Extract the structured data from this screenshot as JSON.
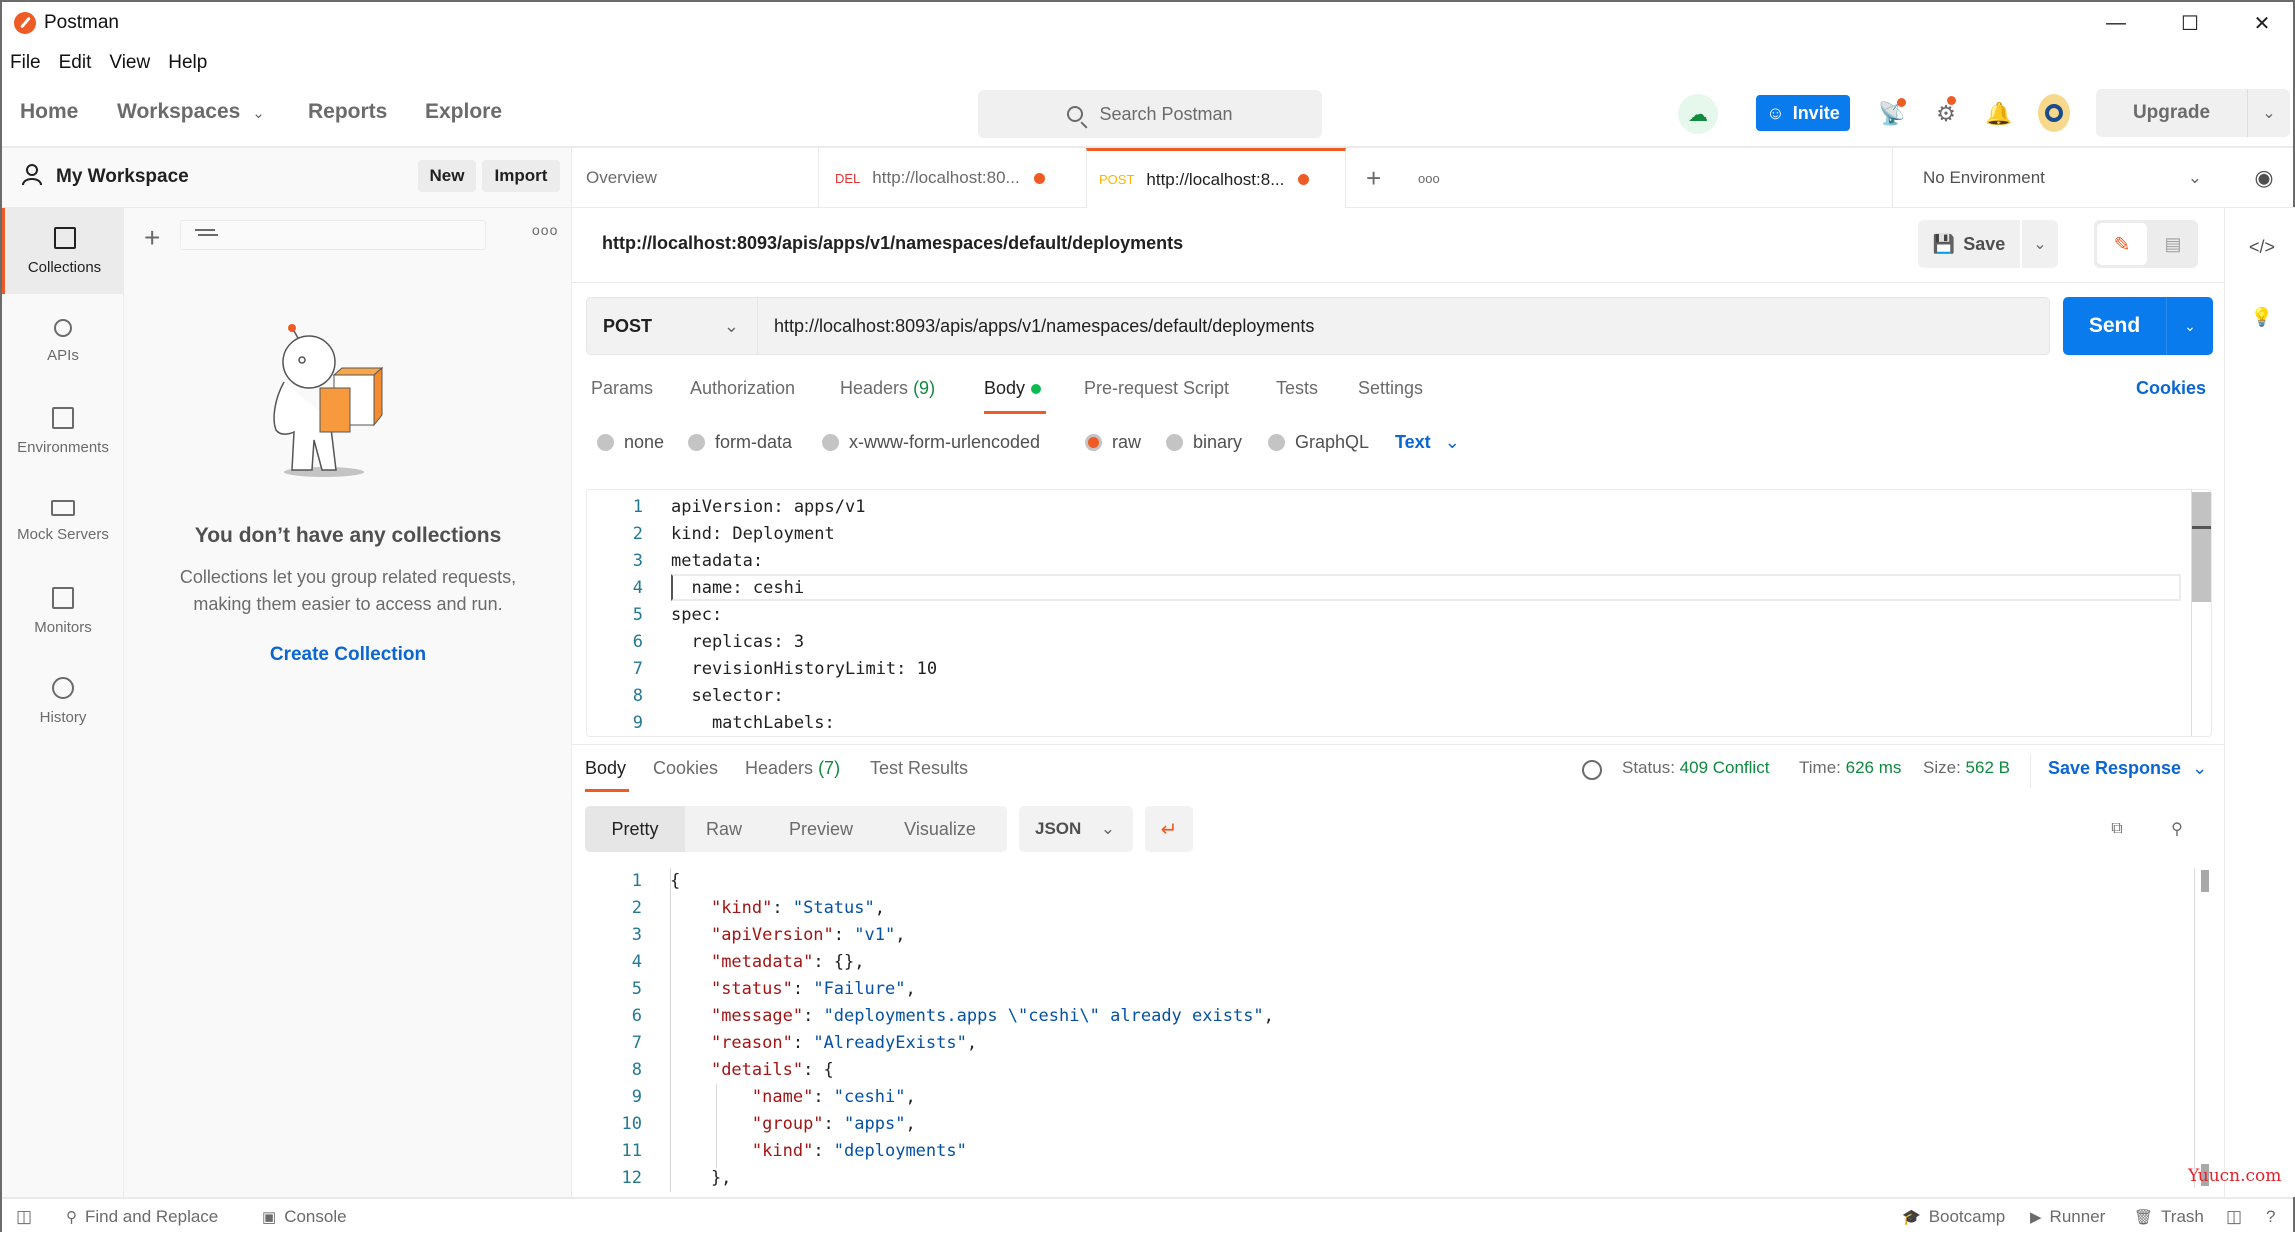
{
  "window": {
    "title": "Postman",
    "controls": {
      "minimize": "—",
      "maximize": "☐",
      "close": "✕"
    }
  },
  "menu": [
    "File",
    "Edit",
    "View",
    "Help"
  ],
  "topnav": {
    "links": [
      "Home",
      "Workspaces",
      "Reports",
      "Explore"
    ],
    "workspaces_chevron": "⌄",
    "search_placeholder": "Search Postman",
    "invite_label": "Invite",
    "upgrade_label": "Upgrade",
    "icons": [
      "cloud-sync-icon",
      "satellite-icon",
      "settings-icon",
      "bell-icon",
      "avatar"
    ]
  },
  "workspace": {
    "title": "My Workspace",
    "new_label": "New",
    "import_label": "Import"
  },
  "rail": [
    {
      "label": "Collections",
      "icon": "collections-icon",
      "active": true
    },
    {
      "label": "APIs",
      "icon": "apis-icon",
      "active": false
    },
    {
      "label": "Environments",
      "icon": "environments-icon",
      "active": false
    },
    {
      "label": "Mock Servers",
      "icon": "mock-servers-icon",
      "active": false
    },
    {
      "label": "Monitors",
      "icon": "monitors-icon",
      "active": false
    },
    {
      "label": "History",
      "icon": "history-icon",
      "active": false
    }
  ],
  "collections": {
    "empty_title": "You don’t have any collections",
    "empty_desc_line1": "Collections let you group related requests,",
    "empty_desc_line2": "making them easier to access and run.",
    "create_label": "Create Collection",
    "more": "ooo"
  },
  "tabs": [
    {
      "label": "Overview",
      "method": "",
      "unsaved": false,
      "active": false
    },
    {
      "label": "http://localhost:80...",
      "method": "DEL",
      "method_color": "#e5322f",
      "unsaved": true,
      "active": false
    },
    {
      "label": "http://localhost:8...",
      "method": "POST",
      "method_color": "#ffb400",
      "unsaved": true,
      "active": true
    }
  ],
  "tabs_actions": {
    "add": "+",
    "more": "ooo"
  },
  "environment": {
    "selected": "No Environment"
  },
  "request": {
    "title": "http://localhost:8093/apis/apps/v1/namespaces/default/deployments",
    "save_label": "Save",
    "method": "POST",
    "url": "http://localhost:8093/apis/apps/v1/namespaces/default/deployments",
    "send_label": "Send",
    "option_tabs": [
      {
        "label": "Params"
      },
      {
        "label": "Authorization"
      },
      {
        "label": "Headers",
        "count": "(9)"
      },
      {
        "label": "Body",
        "active": true,
        "indicator": "green-dot"
      },
      {
        "label": "Pre-request Script"
      },
      {
        "label": "Tests"
      },
      {
        "label": "Settings"
      }
    ],
    "cookies_label": "Cookies",
    "body_types": [
      {
        "label": "none",
        "selected": false
      },
      {
        "label": "form-data",
        "selected": false
      },
      {
        "label": "x-www-form-urlencoded",
        "selected": false
      },
      {
        "label": "raw",
        "selected": true
      },
      {
        "label": "binary",
        "selected": false
      },
      {
        "label": "GraphQL",
        "selected": false
      }
    ],
    "raw_format": "Text",
    "body_lines": [
      "apiVersion: apps/v1",
      "kind: Deployment",
      "metadata:",
      "  name: ceshi",
      "spec:",
      "  replicas: 3",
      "  revisionHistoryLimit: 10",
      "  selector:",
      "    matchLabels:"
    ]
  },
  "response": {
    "tabs": [
      {
        "label": "Body",
        "active": true
      },
      {
        "label": "Cookies"
      },
      {
        "label": "Headers",
        "count": "(7)"
      },
      {
        "label": "Test Results"
      }
    ],
    "status_label": "Status:",
    "status_value": "409 Conflict",
    "time_label": "Time:",
    "time_value": "626 ms",
    "size_label": "Size:",
    "size_value": "562 B",
    "save_response_label": "Save Response",
    "views": [
      "Pretty",
      "Raw",
      "Preview",
      "Visualize"
    ],
    "active_view": "Pretty",
    "format": "JSON",
    "body_lines": [
      [
        {
          "t": "p",
          "v": "{"
        }
      ],
      [
        {
          "t": "p",
          "v": "    "
        },
        {
          "t": "k",
          "v": "\"kind\""
        },
        {
          "t": "p",
          "v": ": "
        },
        {
          "t": "s",
          "v": "\"Status\""
        },
        {
          "t": "p",
          "v": ","
        }
      ],
      [
        {
          "t": "p",
          "v": "    "
        },
        {
          "t": "k",
          "v": "\"apiVersion\""
        },
        {
          "t": "p",
          "v": ": "
        },
        {
          "t": "s",
          "v": "\"v1\""
        },
        {
          "t": "p",
          "v": ","
        }
      ],
      [
        {
          "t": "p",
          "v": "    "
        },
        {
          "t": "k",
          "v": "\"metadata\""
        },
        {
          "t": "p",
          "v": ": {},"
        }
      ],
      [
        {
          "t": "p",
          "v": "    "
        },
        {
          "t": "k",
          "v": "\"status\""
        },
        {
          "t": "p",
          "v": ": "
        },
        {
          "t": "s",
          "v": "\"Failure\""
        },
        {
          "t": "p",
          "v": ","
        }
      ],
      [
        {
          "t": "p",
          "v": "    "
        },
        {
          "t": "k",
          "v": "\"message\""
        },
        {
          "t": "p",
          "v": ": "
        },
        {
          "t": "s",
          "v": "\"deployments.apps \\\"ceshi\\\" already exists\""
        },
        {
          "t": "p",
          "v": ","
        }
      ],
      [
        {
          "t": "p",
          "v": "    "
        },
        {
          "t": "k",
          "v": "\"reason\""
        },
        {
          "t": "p",
          "v": ": "
        },
        {
          "t": "s",
          "v": "\"AlreadyExists\""
        },
        {
          "t": "p",
          "v": ","
        }
      ],
      [
        {
          "t": "p",
          "v": "    "
        },
        {
          "t": "k",
          "v": "\"details\""
        },
        {
          "t": "p",
          "v": ": {"
        }
      ],
      [
        {
          "t": "p",
          "v": "        "
        },
        {
          "t": "k",
          "v": "\"name\""
        },
        {
          "t": "p",
          "v": ": "
        },
        {
          "t": "s",
          "v": "\"ceshi\""
        },
        {
          "t": "p",
          "v": ","
        }
      ],
      [
        {
          "t": "p",
          "v": "        "
        },
        {
          "t": "k",
          "v": "\"group\""
        },
        {
          "t": "p",
          "v": ": "
        },
        {
          "t": "s",
          "v": "\"apps\""
        },
        {
          "t": "p",
          "v": ","
        }
      ],
      [
        {
          "t": "p",
          "v": "        "
        },
        {
          "t": "k",
          "v": "\"kind\""
        },
        {
          "t": "p",
          "v": ": "
        },
        {
          "t": "s",
          "v": "\"deployments\""
        }
      ],
      [
        {
          "t": "p",
          "v": "    },"
        }
      ]
    ]
  },
  "statusbar": {
    "find_replace": "Find and Replace",
    "console": "Console",
    "bootcamp": "Bootcamp",
    "runner": "Runner",
    "trash": "Trash"
  },
  "watermark": "Yuucn.com",
  "colors": {
    "accent": "#ef5b25",
    "primary_blue": "#097bed",
    "link_blue": "#0b66d3",
    "success_green": "#0f8a3e"
  }
}
